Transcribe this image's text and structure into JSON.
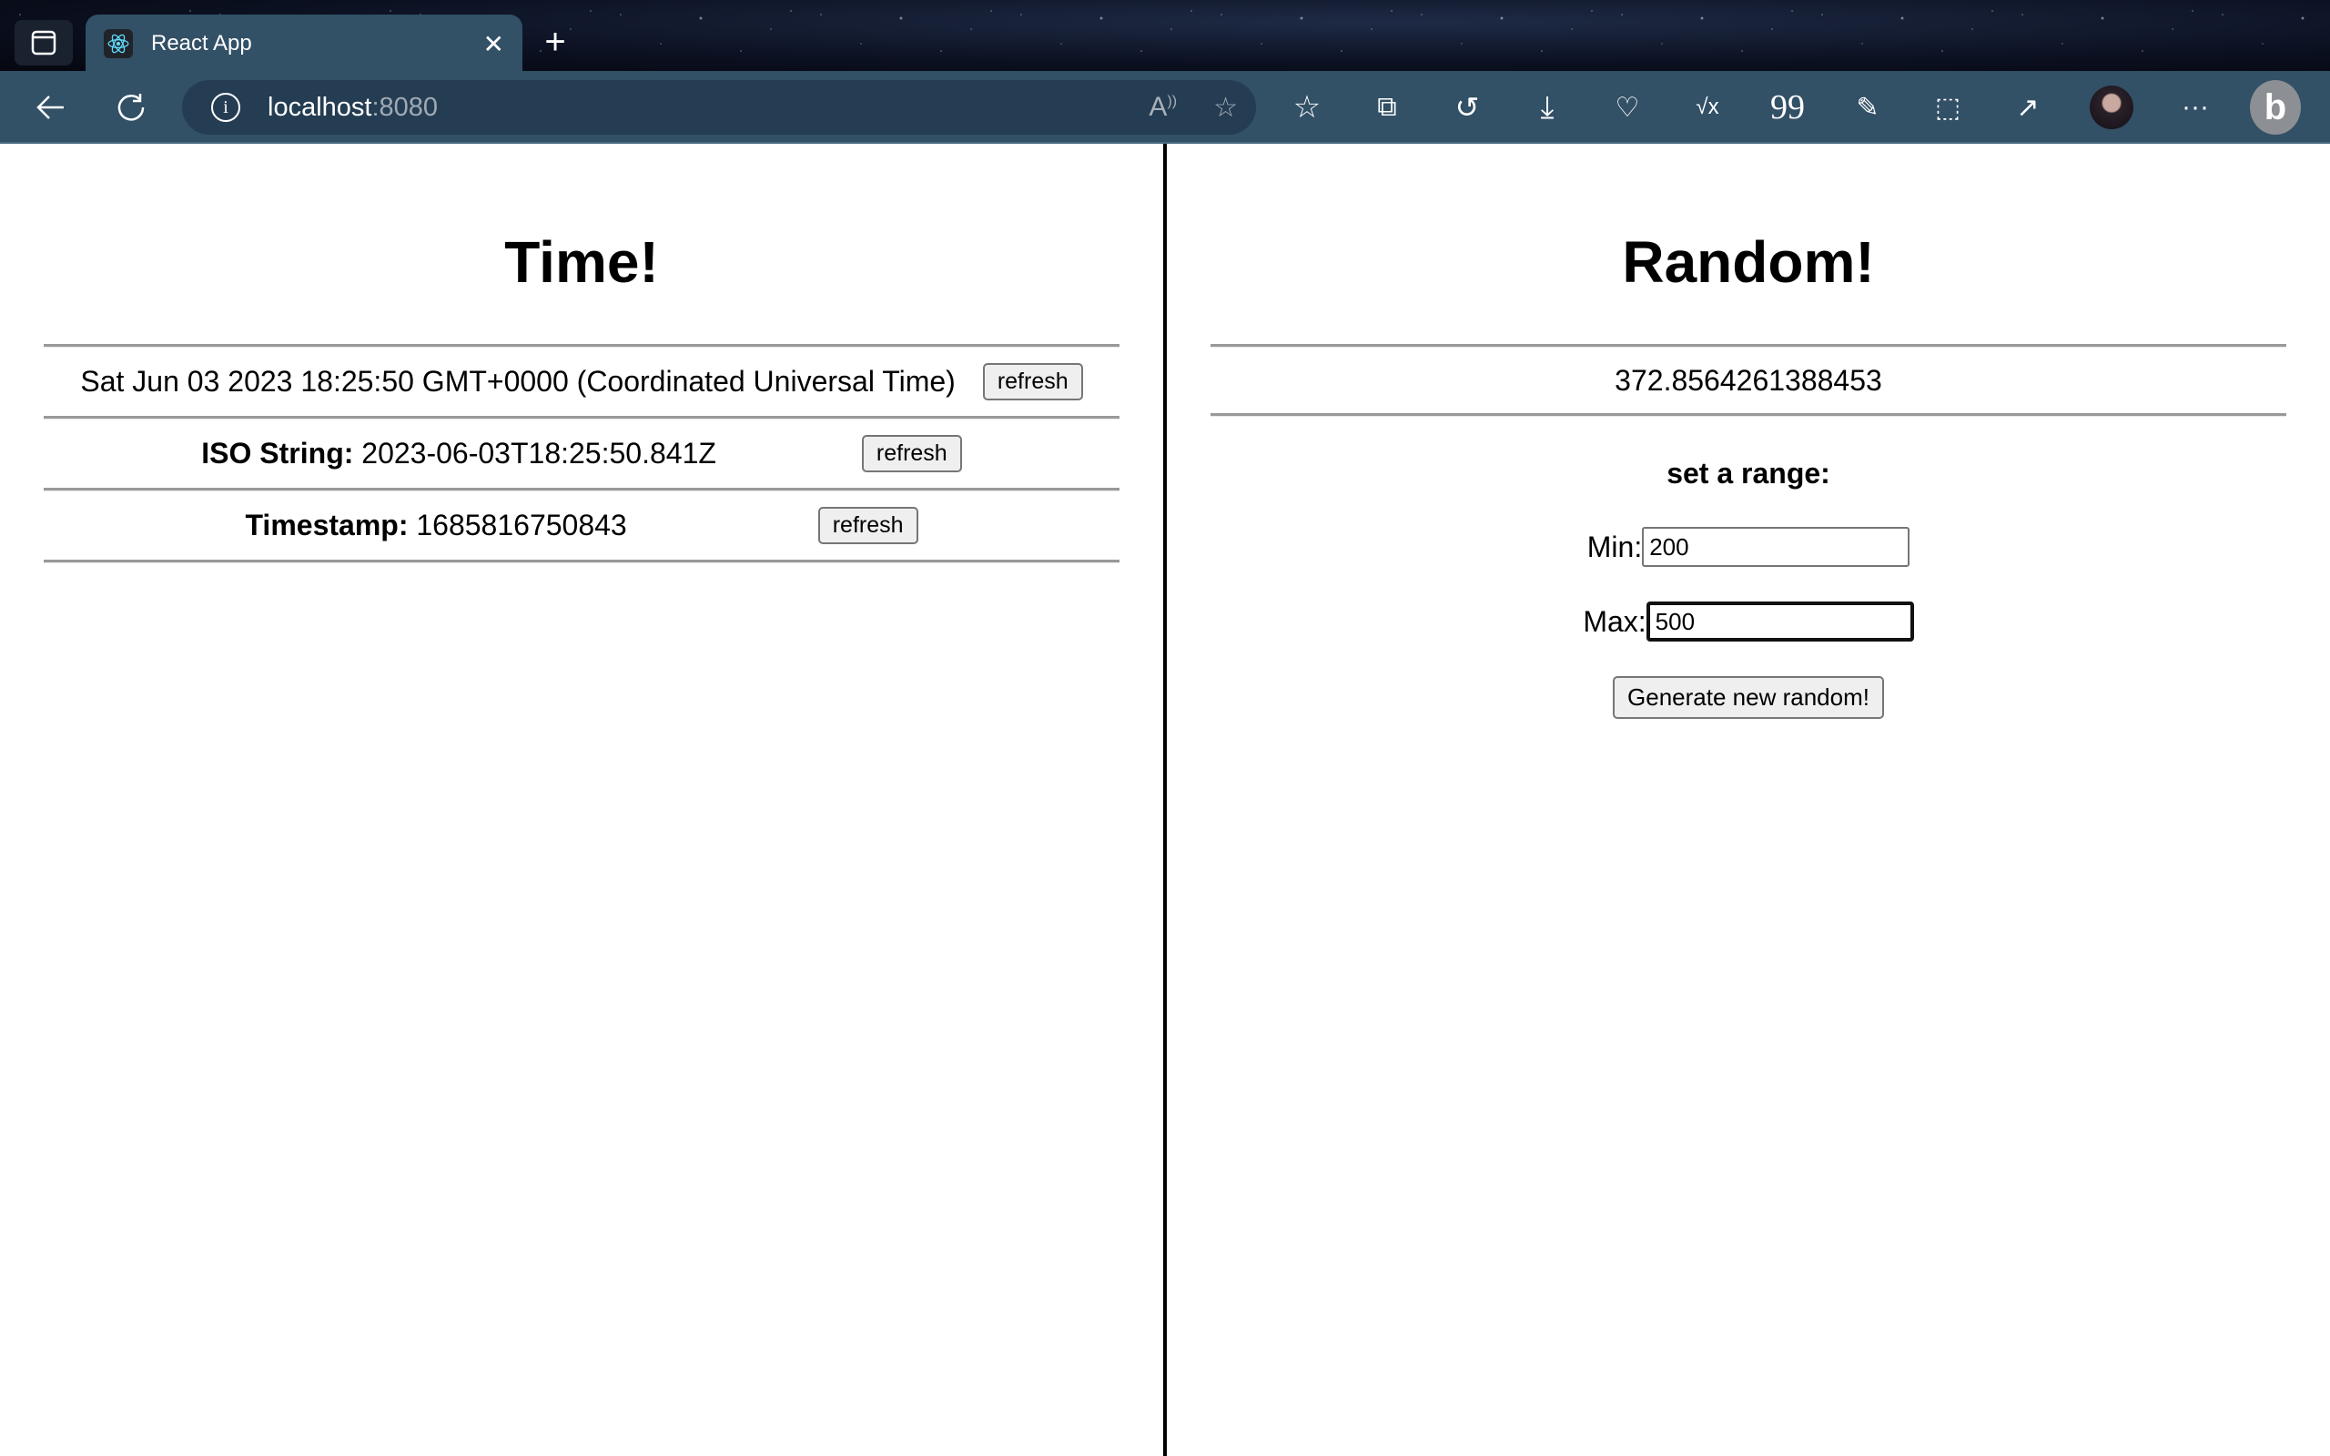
{
  "browser": {
    "tab_title": "React App",
    "url_host": "localhost",
    "url_port": ":8080",
    "toolbar_icons": [
      "favorites-icon",
      "collections-icon",
      "history-icon",
      "downloads-icon",
      "health-icon",
      "math-solver-icon",
      "citations-icon",
      "web-capture-icon",
      "screenshot-icon",
      "share-icon",
      "profile-avatar",
      "more-icon",
      "bing-icon"
    ]
  },
  "time_panel": {
    "title": "Time!",
    "rows": [
      {
        "label": "",
        "value": "Sat Jun 03 2023 18:25:50 GMT+0000 (Coordinated Universal Time)",
        "button": "refresh"
      },
      {
        "label": "ISO String:",
        "value": " 2023-06-03T18:25:50.841Z",
        "button": "refresh"
      },
      {
        "label": "Timestamp:",
        "value": " 1685816750843",
        "button": "refresh"
      }
    ]
  },
  "random_panel": {
    "title": "Random!",
    "value": "372.8564261388453",
    "range_title": "set a range:",
    "min_label": "Min:",
    "min_value": "200",
    "max_label": "Max:",
    "max_value": "500",
    "generate_button": "Generate new random!"
  }
}
